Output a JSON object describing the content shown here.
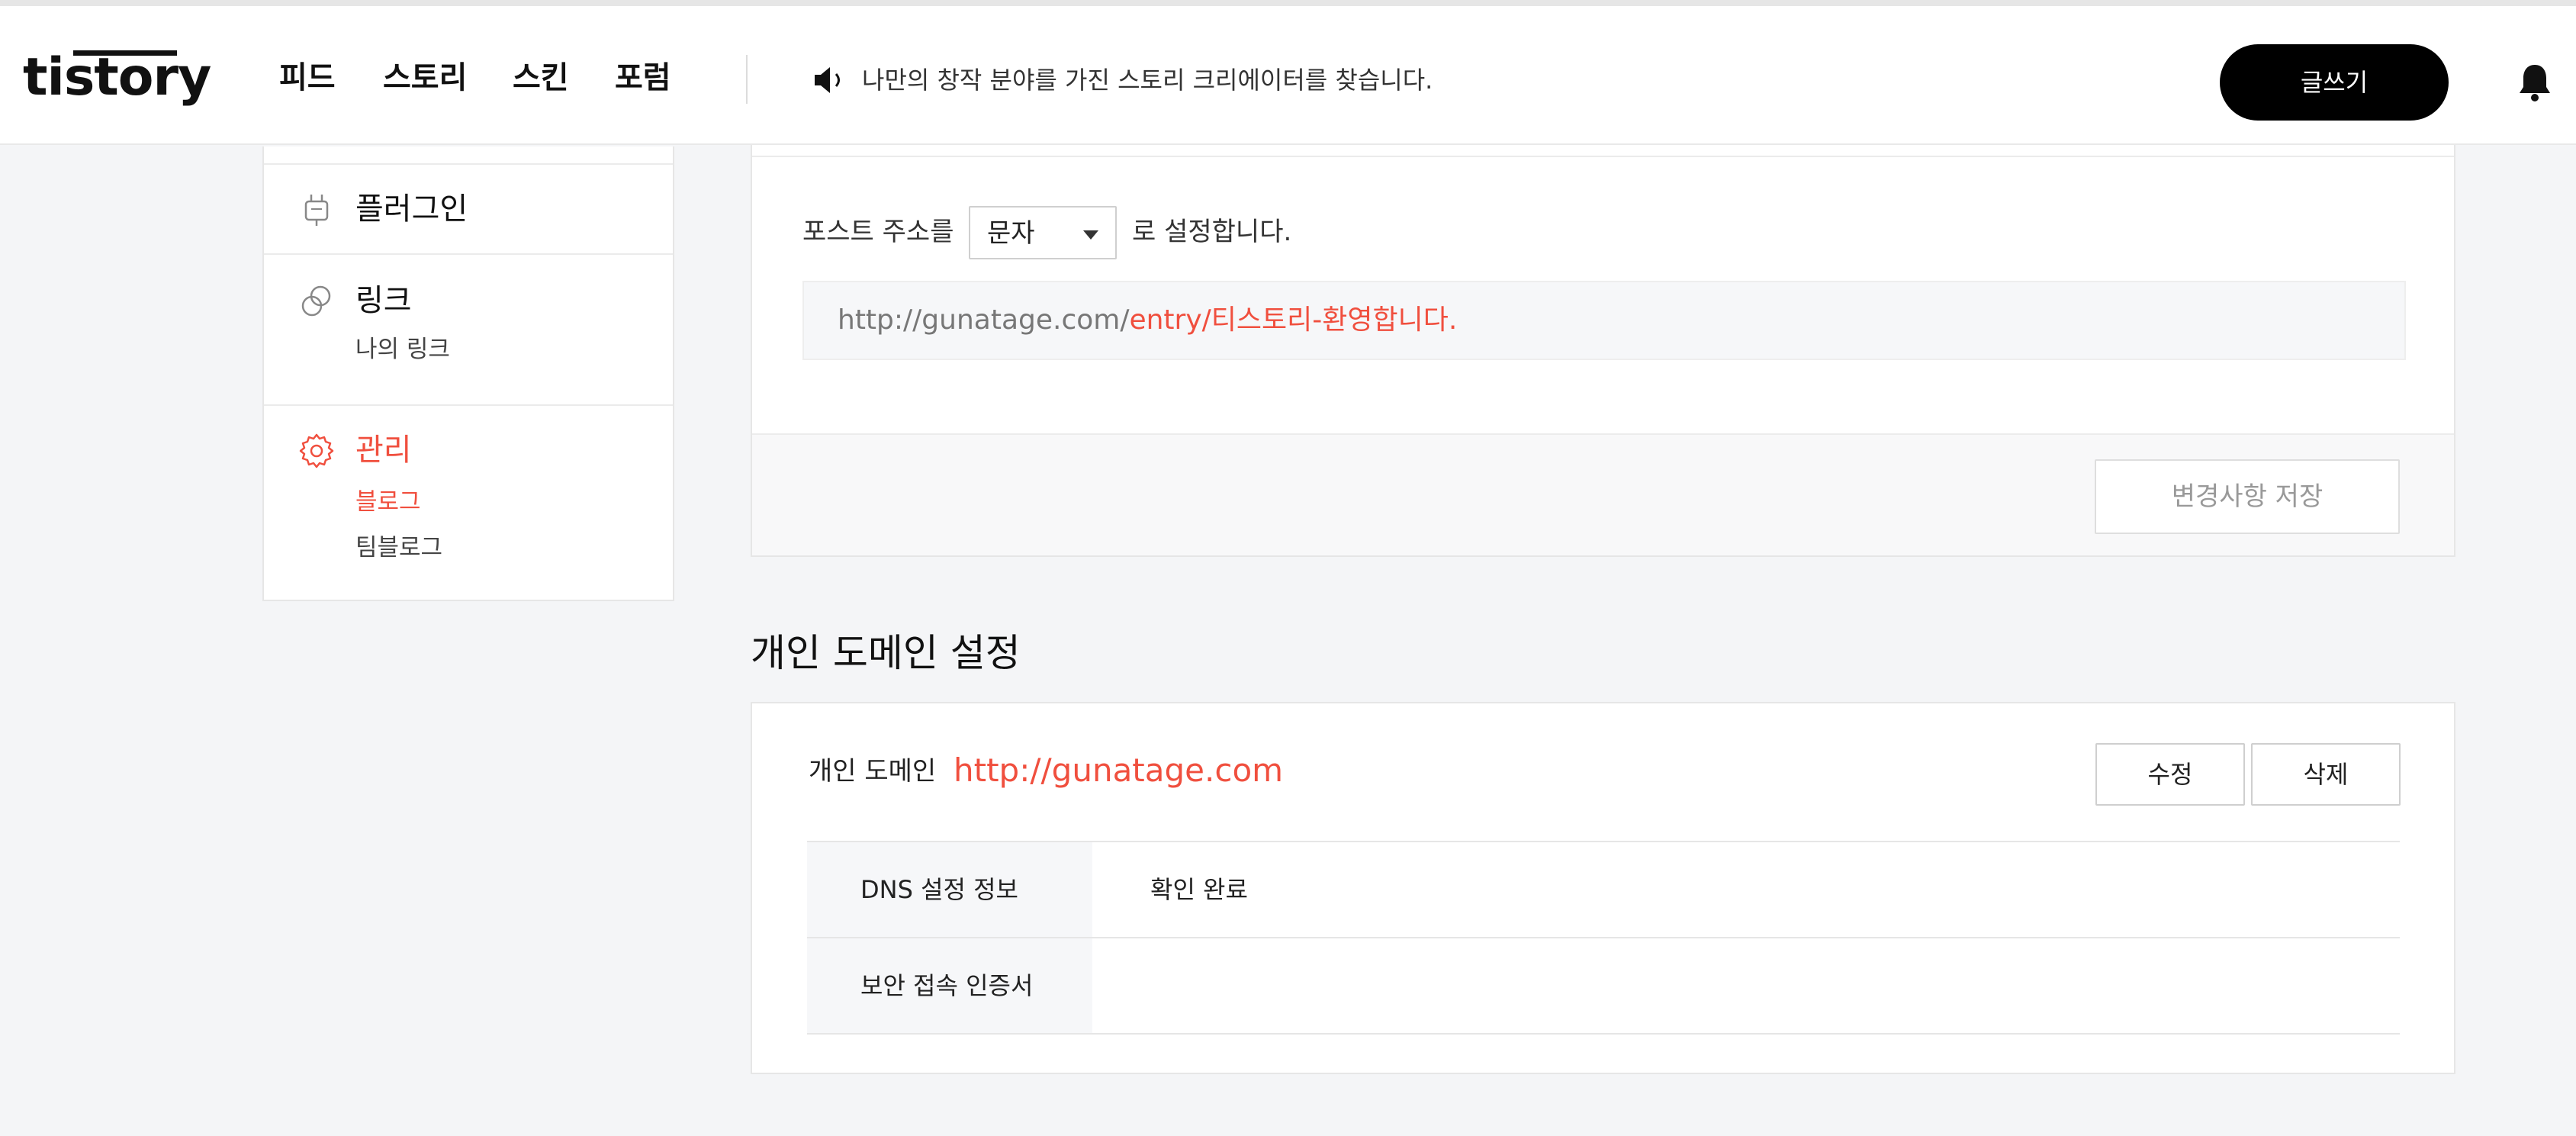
{
  "header": {
    "logo": "tistory",
    "nav": [
      "피드",
      "스토리",
      "스킨",
      "포럼"
    ],
    "notice_icon": "speaker-icon",
    "notice": "나만의 창작 분야를 가진 스토리 크리에이터를 찾습니다.",
    "write_label": "글쓰기",
    "bell_icon": "bell-icon"
  },
  "sidebar": {
    "items": [
      {
        "icon": "plug-icon",
        "label": "플러그인",
        "subitems": []
      },
      {
        "icon": "link-icon",
        "label": "링크",
        "subitems": [
          {
            "label": "나의 링크",
            "active": false
          }
        ]
      },
      {
        "icon": "gear-icon",
        "label": "관리",
        "active": true,
        "subitems": [
          {
            "label": "블로그",
            "active": true
          },
          {
            "label": "팀블로그",
            "active": false
          }
        ]
      }
    ]
  },
  "post_address": {
    "prefix": "포스트 주소를",
    "select_value": "문자",
    "suffix": "로 설정합니다.",
    "preview_base": "http://gunatage.com/",
    "preview_path": "entry/티스토리-환영합니다.",
    "save_label": "변경사항 저장"
  },
  "custom_domain": {
    "section_title": "개인 도메인 설정",
    "label": "개인 도메인",
    "value": "http://gunatage.com",
    "edit_label": "수정",
    "delete_label": "삭제",
    "rows": [
      {
        "header": "DNS 설정 정보",
        "value": "확인 완료"
      },
      {
        "header": "보안 접속 인증서",
        "value": ""
      }
    ]
  },
  "colors": {
    "accent": "#f04f3e",
    "header_bg": "#ffffff",
    "page_bg": "#f4f5f7",
    "button_dark": "#000000"
  }
}
